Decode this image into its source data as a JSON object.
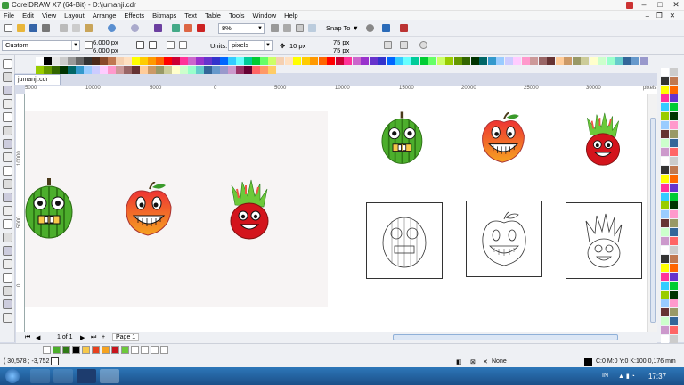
{
  "window": {
    "title": "CorelDRAW X7 (64-Bit) - D:\\jumanji.cdr"
  },
  "menu": [
    "File",
    "Edit",
    "View",
    "Layout",
    "Arrange",
    "Effects",
    "Bitmaps",
    "Text",
    "Table",
    "Tools",
    "Window",
    "Help"
  ],
  "toolbar": {
    "zoom": "8%",
    "snap_label": "Snap To"
  },
  "propbar": {
    "preset": "Custom",
    "width1": "6,000 px",
    "width2": "6,000 px",
    "units_label": "Units:",
    "units": "pixels",
    "nudge": "10 px",
    "dup_x": "75 px",
    "dup_y": "75 px"
  },
  "doc_tab": "jumanji.cdr",
  "ruler_h": [
    "5000",
    "10000",
    "5000",
    "0",
    "5000",
    "10000",
    "15000",
    "20000",
    "25000",
    "30000",
    "pixels"
  ],
  "ruler_v": [
    "10000",
    "5000",
    "0"
  ],
  "pagebar": {
    "page_count": "1 of 1",
    "page_tab": "Page 1"
  },
  "status": {
    "coords": "( 30,578 ; -3,752 )",
    "fill": "None",
    "outline": "C:0 M:0 Y:0 K:100  0,176 mm"
  },
  "taskbar": {
    "lang": "IN",
    "time": "17:37"
  },
  "colors": {
    "accent": "#3d9a3c",
    "watermelon": "#4caf2a",
    "apple": "#e8401c",
    "dragonfruit": "#c8141c"
  }
}
